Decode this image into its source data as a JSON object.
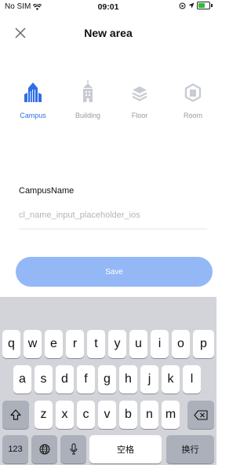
{
  "status_bar": {
    "carrier": "No SIM",
    "time": "09:01"
  },
  "nav": {
    "title": "New area"
  },
  "area_types": [
    {
      "label": "Campus",
      "icon": "campus-icon",
      "active": true
    },
    {
      "label": "Building",
      "icon": "building-icon",
      "active": false
    },
    {
      "label": "Floor",
      "icon": "floor-icon",
      "active": false
    },
    {
      "label": "Room",
      "icon": "room-icon",
      "active": false
    }
  ],
  "form": {
    "label": "CampusName",
    "value": "",
    "placeholder": "cl_name_input_placeholder_ios"
  },
  "save_label": "Save",
  "colors": {
    "accent": "#2f6ee8",
    "button": "#94b8f6",
    "inactive": "#9a9a9a",
    "keyboard_bg": "#d2d4d9"
  },
  "keyboard": {
    "row1": [
      "q",
      "w",
      "e",
      "r",
      "t",
      "y",
      "u",
      "i",
      "o",
      "p"
    ],
    "row2": [
      "a",
      "s",
      "d",
      "f",
      "g",
      "h",
      "j",
      "k",
      "l"
    ],
    "row3": [
      "z",
      "x",
      "c",
      "v",
      "b",
      "n",
      "m"
    ],
    "num_label": "123",
    "space_label": "空格",
    "return_label": "换行"
  }
}
